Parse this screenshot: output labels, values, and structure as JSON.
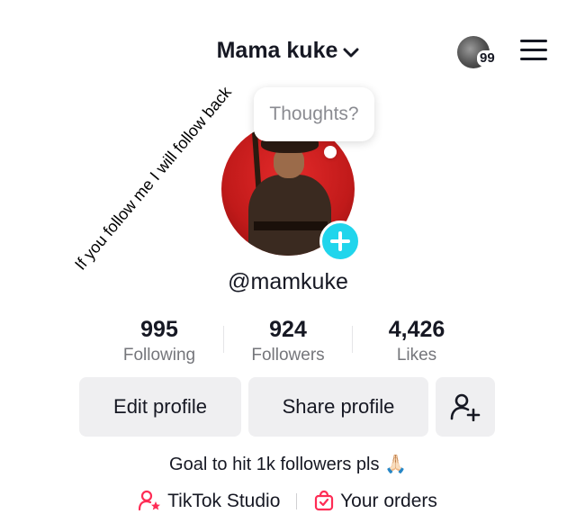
{
  "header": {
    "username": "Mama kuke",
    "notification_count": "99"
  },
  "overlay_text": "If you follow me I will follow back",
  "bubble": {
    "text": "Thoughts?"
  },
  "profile": {
    "handle": "@mamkuke"
  },
  "stats": [
    {
      "value": "995",
      "label": "Following"
    },
    {
      "value": "924",
      "label": "Followers"
    },
    {
      "value": "4,426",
      "label": "Likes"
    }
  ],
  "buttons": {
    "edit": "Edit profile",
    "share": "Share profile"
  },
  "bio": "Goal to hit 1k followers pls 🙏🏻",
  "links": {
    "studio": "TikTok Studio",
    "orders": "Your orders"
  },
  "colors": {
    "accent": "#20d5ec",
    "brand_pink": "#fe2c55",
    "button_bg": "#efeff1"
  }
}
